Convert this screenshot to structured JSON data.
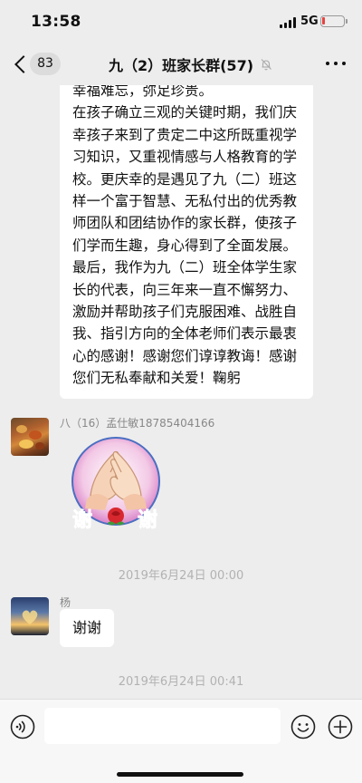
{
  "status_bar": {
    "time": "13:58",
    "network": "5G",
    "battery_level": 0.12,
    "battery_color": "#e64340"
  },
  "nav": {
    "back_icon": "chevron-left-icon",
    "unread_count": "83",
    "title": "九（2）班家长群(57)",
    "mute_icon": "bell-off-icon",
    "more_icon": "more-horizontal-icon"
  },
  "messages": {
    "long_text": "幸福难忘，弥足珍贵。\n在孩子确立三观的关键时期，我们庆幸孩子来到了贵定二中这所既重视学习知识，又重视情感与人格教育的学校。更庆幸的是遇见了九（二）班这样一个富于智慧、无私付出的优秀教师团队和团结协作的家长群，使孩子们学而生趣，身心得到了全面发展。\n最后，我作为九（二）班全体学生家长的代表，向三年来一直不懈努力、激励并帮助孩子们克服困难、战胜自我、指引方向的全体老师们表示最衷心的感谢！感谢您们谆谆教诲！感谢您们无私奉献和关爱！鞠躬",
    "sender_1": "八（16）孟仕敏18785404166",
    "sticker_text": "谢谢",
    "timestamp_1": "2019年6月24日 00:00",
    "sender_2": "杨",
    "short_text": "谢谢",
    "timestamp_2": "2019年6月24日 00:41"
  },
  "input_bar": {
    "voice_icon": "voice-icon",
    "placeholder": "",
    "emoji_icon": "smile-icon",
    "plus_icon": "plus-circle-icon"
  },
  "colors": {
    "background": "#ededed",
    "bubble": "#ffffff",
    "timestamp": "#b2b2b2",
    "sender_name": "#888888"
  }
}
